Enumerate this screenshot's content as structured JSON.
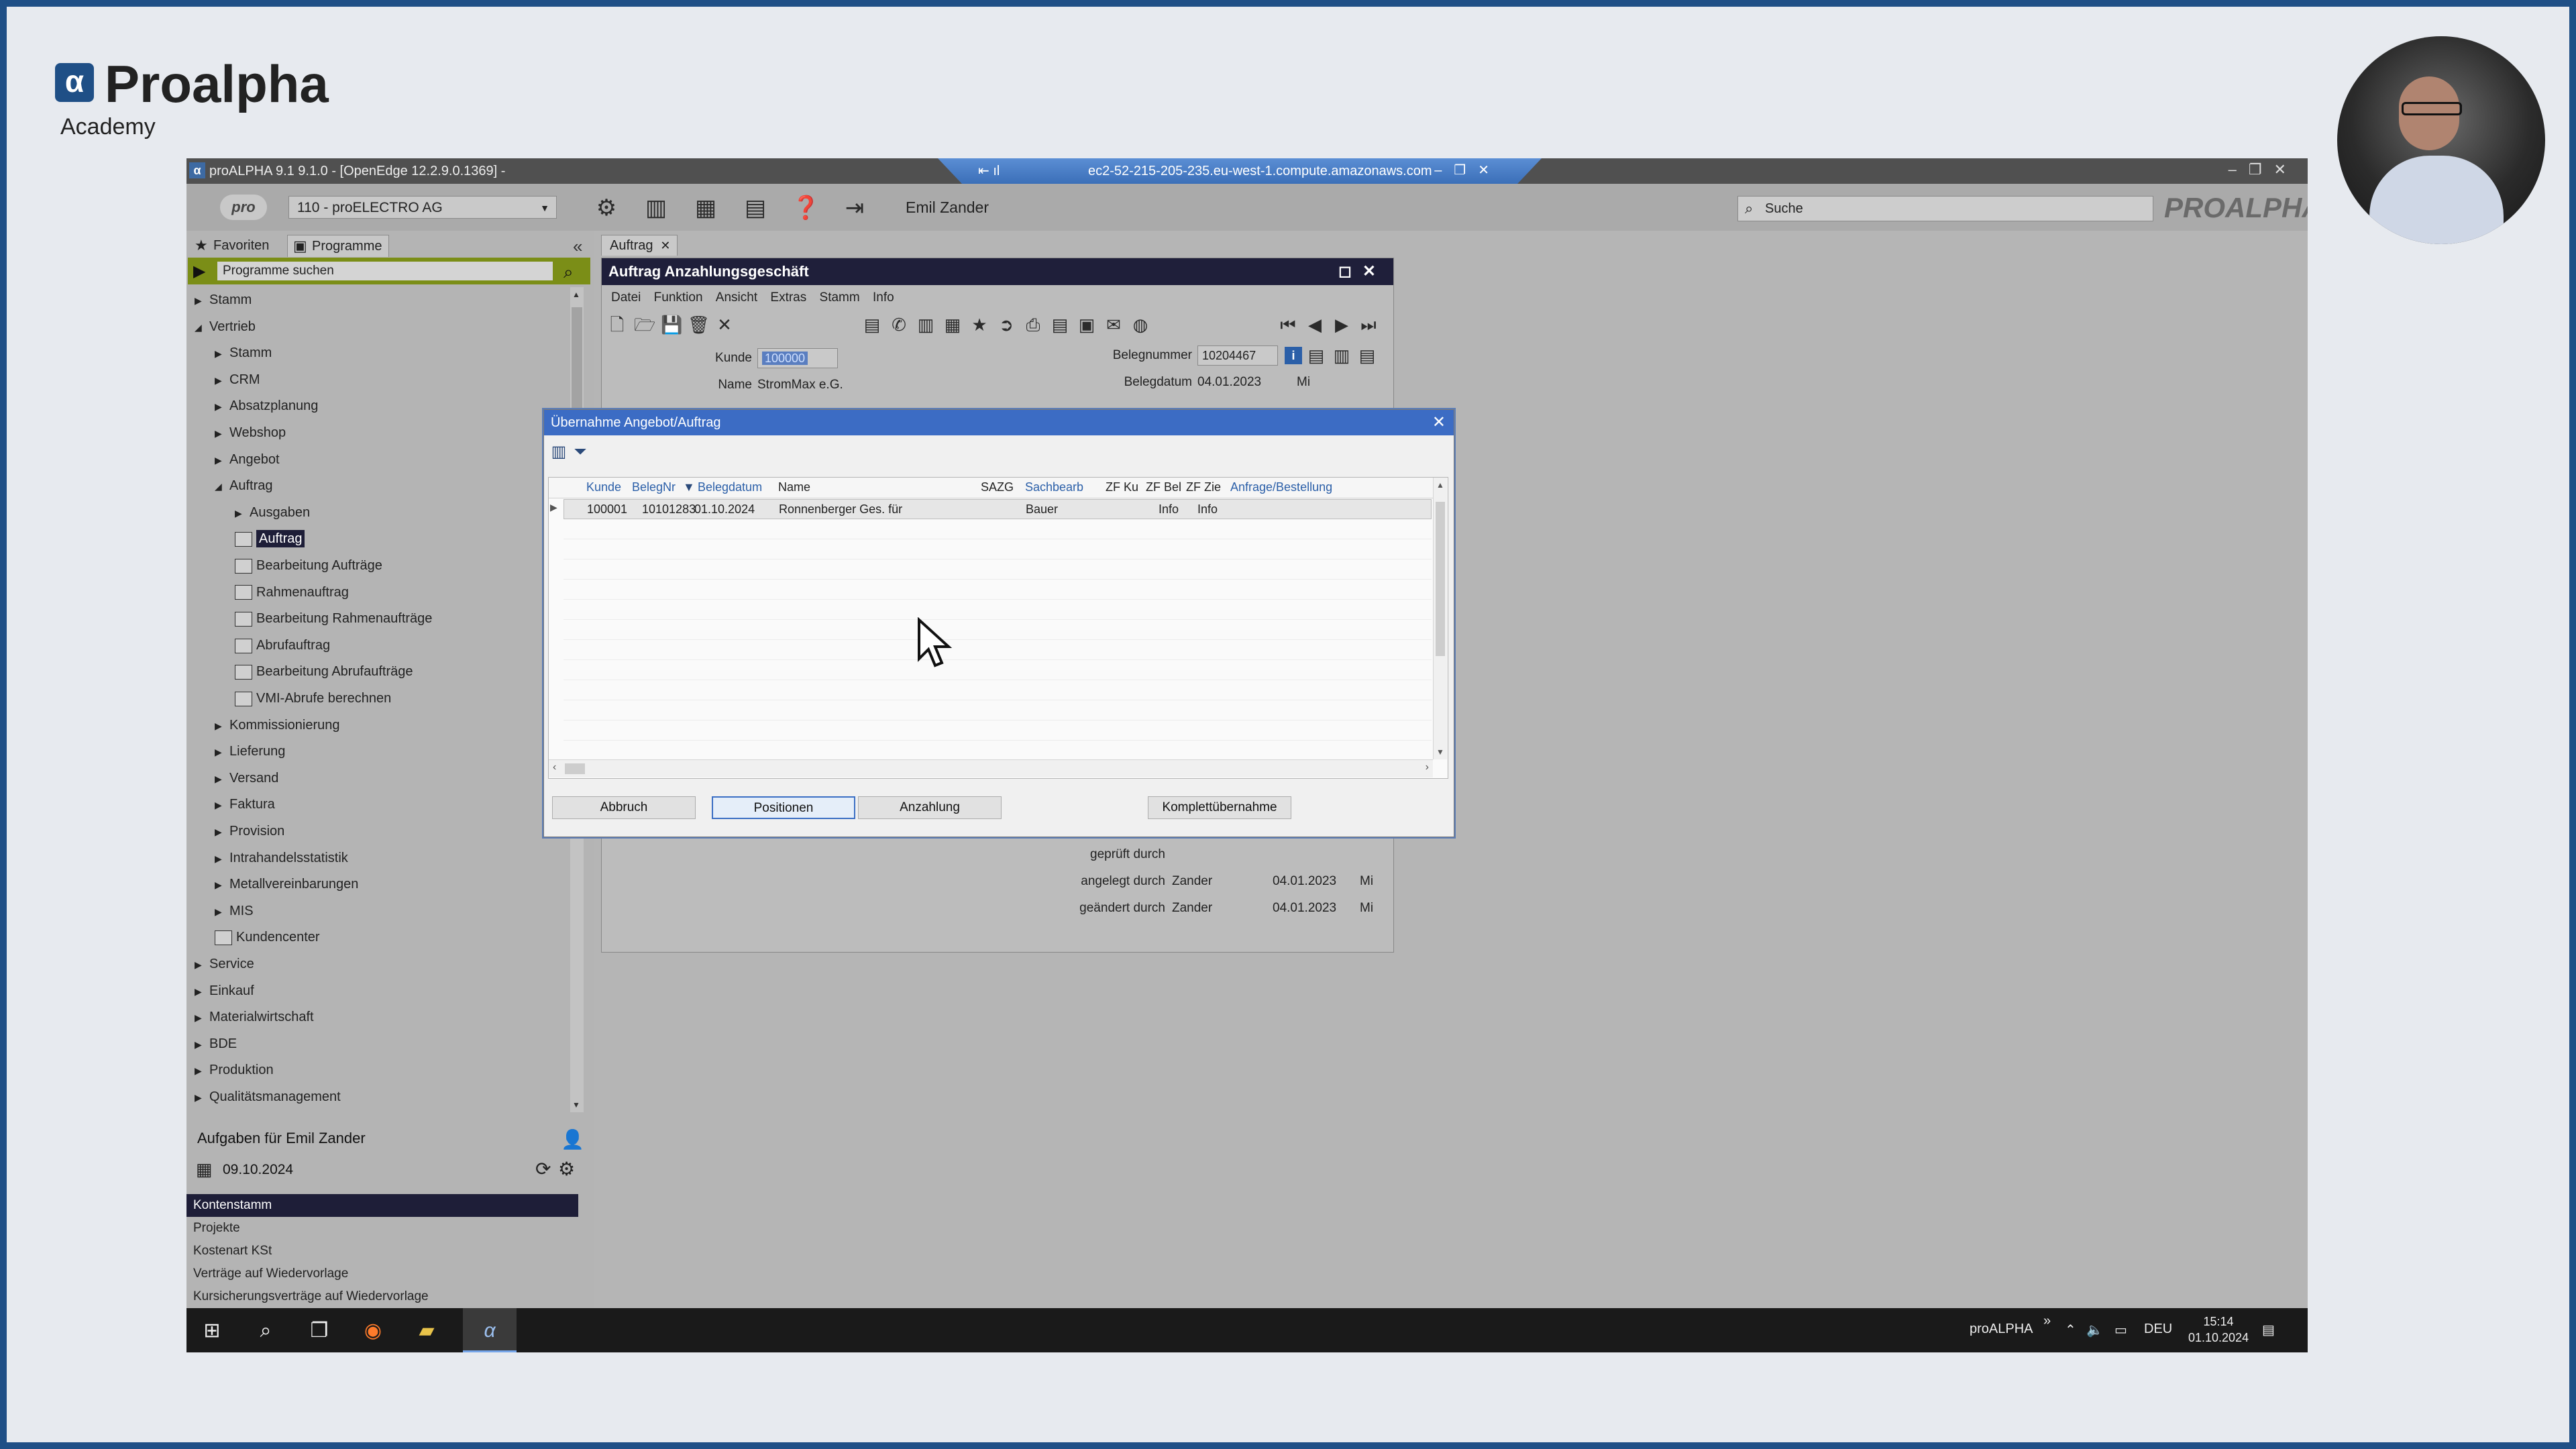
{
  "branding": {
    "logo_glyph": "α",
    "name": "Proalpha",
    "subtitle": "Academy"
  },
  "window": {
    "title": "proALPHA 9.1 9.1.0 - [OpenEdge 12.2.9.0.1369] -",
    "remote_host": "ec2-52-215-205-235.eu-west-1.compute.amazonaws.com"
  },
  "toolbar": {
    "pro_logo": "pro",
    "company": "110 - proELECTRO AG",
    "user": "Emil Zander",
    "search_placeholder": "Suche",
    "brand_logo": "PROALPHA"
  },
  "left_panel": {
    "tabs": [
      {
        "label": "Favoriten"
      },
      {
        "label": "Programme"
      }
    ],
    "program_search": "Programme suchen",
    "tree": [
      {
        "label": "Stamm",
        "level": 0,
        "expanded": false
      },
      {
        "label": "Vertrieb",
        "level": 0,
        "expanded": true
      },
      {
        "label": "Stamm",
        "level": 1,
        "expanded": false
      },
      {
        "label": "CRM",
        "level": 1,
        "expanded": false
      },
      {
        "label": "Absatzplanung",
        "level": 1,
        "expanded": false
      },
      {
        "label": "Webshop",
        "level": 1,
        "expanded": false
      },
      {
        "label": "Angebot",
        "level": 1,
        "expanded": false
      },
      {
        "label": "Auftrag",
        "level": 1,
        "expanded": true
      },
      {
        "label": "Ausgaben",
        "level": 2,
        "expanded": false
      },
      {
        "label": "Auftrag",
        "level": 2,
        "leaf": true,
        "selected": true
      },
      {
        "label": "Bearbeitung Aufträge",
        "level": 2,
        "leaf": true
      },
      {
        "label": "Rahmenauftrag",
        "level": 2,
        "leaf": true
      },
      {
        "label": "Bearbeitung Rahmenaufträge",
        "level": 2,
        "leaf": true
      },
      {
        "label": "Abrufauftrag",
        "level": 2,
        "leaf": true
      },
      {
        "label": "Bearbeitung Abrufaufträge",
        "level": 2,
        "leaf": true
      },
      {
        "label": "VMI-Abrufe berechnen",
        "level": 2,
        "leaf": true
      },
      {
        "label": "Kommissionierung",
        "level": 1,
        "expanded": false
      },
      {
        "label": "Lieferung",
        "level": 1,
        "expanded": false
      },
      {
        "label": "Versand",
        "level": 1,
        "expanded": false
      },
      {
        "label": "Faktura",
        "level": 1,
        "expanded": false
      },
      {
        "label": "Provision",
        "level": 1,
        "expanded": false
      },
      {
        "label": "Intrahandelsstatistik",
        "level": 1,
        "expanded": false
      },
      {
        "label": "Metallvereinbarungen",
        "level": 1,
        "expanded": false
      },
      {
        "label": "MIS",
        "level": 1,
        "expanded": false
      },
      {
        "label": "Kundencenter",
        "level": 1,
        "leaf": true
      },
      {
        "label": "Service",
        "level": 0,
        "expanded": false
      },
      {
        "label": "Einkauf",
        "level": 0,
        "expanded": false
      },
      {
        "label": "Materialwirtschaft",
        "level": 0,
        "expanded": false
      },
      {
        "label": "BDE",
        "level": 0,
        "expanded": false
      },
      {
        "label": "Produktion",
        "level": 0,
        "expanded": false
      },
      {
        "label": "Qualitätsmanagement",
        "level": 0,
        "expanded": false
      }
    ],
    "tasks": {
      "title": "Aufgaben für Emil Zander",
      "date": "09.10.2024",
      "items": [
        {
          "label": "Kontenstamm",
          "selected": true
        },
        {
          "label": "Projekte"
        },
        {
          "label": "Kostenart KSt"
        },
        {
          "label": "Verträge auf Wiedervorlage"
        },
        {
          "label": "Kursicherungsverträge auf Wiedervorlage"
        }
      ]
    }
  },
  "main": {
    "tab_label": "Auftrag",
    "form_title": "Auftrag Anzahlungsgeschäft",
    "menu": [
      "Datei",
      "Funktion",
      "Ansicht",
      "Extras",
      "Stamm",
      "Info"
    ],
    "fields": {
      "kunde_label": "Kunde",
      "kunde_value": "100000",
      "name_label": "Name",
      "name_value": "StromMax e.G.",
      "belegnummer_label": "Belegnummer",
      "belegnummer_value": "10204467",
      "belegdatum_label": "Belegdatum",
      "belegdatum_value": "04.01.2023",
      "belegdatum_day": "Mi",
      "geprueft_label": "geprüft durch",
      "angelegt_label": "angelegt durch",
      "angelegt_user": "Zander",
      "angelegt_date": "04.01.2023",
      "angelegt_day": "Mi",
      "geaendert_label": "geändert durch",
      "geaendert_user": "Zander",
      "geaendert_date": "04.01.2023",
      "geaendert_day": "Mi"
    }
  },
  "dialog": {
    "title": "Übernahme Angebot/Auftrag",
    "columns": [
      "Kunde",
      "BelegNr",
      "Belegdatum",
      "Name",
      "SAZG",
      "Sachbearb",
      "ZF Ku",
      "ZF Bel",
      "ZF Zie",
      "Anfrage/Bestellung"
    ],
    "rows": [
      {
        "kunde": "100001",
        "belegnr": "10101283",
        "belegdatum": "01.10.2024",
        "name": "Ronnenberger Ges. für",
        "sazg": "",
        "sachbearb": "Bauer",
        "zf_ku": "",
        "zf_bel": "Info",
        "zf_zie": "Info",
        "anfrage": ""
      }
    ],
    "buttons": {
      "cancel": "Abbruch",
      "positions": "Positionen",
      "deposit": "Anzahlung",
      "complete": "Komplettübernahme"
    }
  },
  "taskbar": {
    "tray_app": "proALPHA",
    "language": "DEU",
    "time": "15:14",
    "date": "01.10.2024"
  }
}
